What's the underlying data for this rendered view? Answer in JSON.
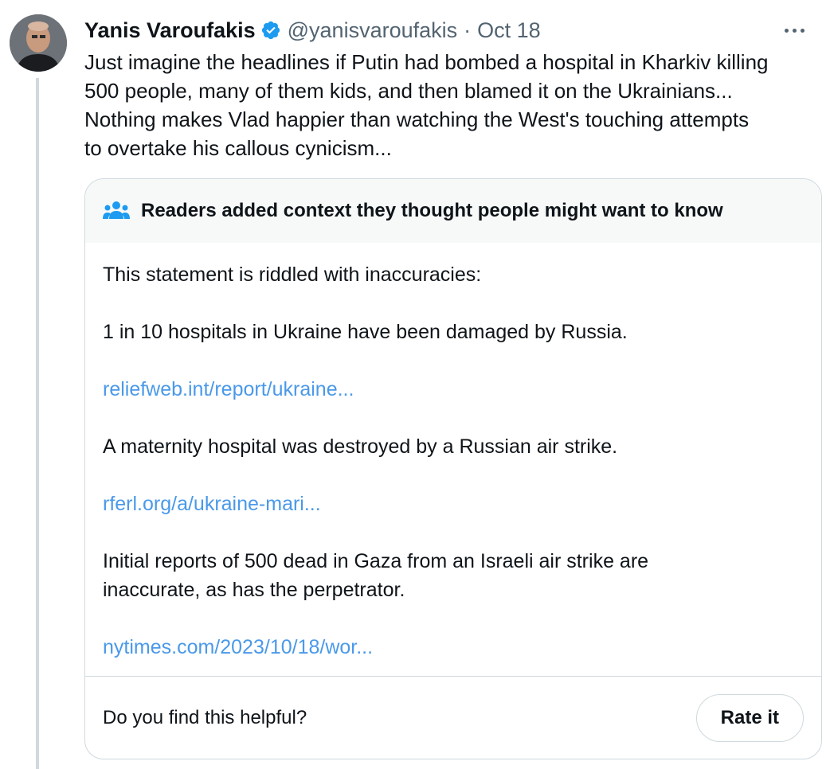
{
  "author": {
    "name": "Yanis Varoufakis",
    "handle": "@yanisvaroufakis",
    "separator": "·",
    "date": "Oct 18",
    "verified_icon": "verified-badge-icon",
    "verified_color": "#1d9bf0"
  },
  "tweet": {
    "lines": [
      "Just imagine the headlines if Putin had bombed a hospital in Kharkiv killing",
      "500 people, many of them kids, and then blamed it on the Ukrainians...",
      "Nothing makes Vlad happier than watching the West's touching attempts",
      "to overtake his callous cynicism..."
    ]
  },
  "note": {
    "header": "Readers added context they thought people might want to know",
    "header_icon": "people-icon",
    "intro": "This statement is riddled with inaccuracies:",
    "item1": "1 in 10 hospitals in Ukraine have been damaged by Russia.",
    "link1": "reliefweb.int/report/ukraine...",
    "item2": "A maternity hospital was destroyed by a Russian air strike.",
    "link2": "rferl.org/a/ukraine-mari...",
    "item3_line1": "Initial reports of 500 dead in Gaza from an Israeli air strike are",
    "item3_line2": "inaccurate, as has the perpetrator.",
    "link3": "nytimes.com/2023/10/18/wor...",
    "question": "Do you find this helpful?",
    "rate_label": "Rate it",
    "link_color": "#1d9bf0"
  }
}
